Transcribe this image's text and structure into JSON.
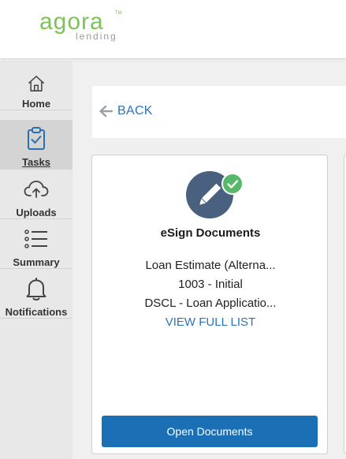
{
  "brand": {
    "name": "agora",
    "sub": "lending",
    "tm": "TM",
    "color": "#7cc35a"
  },
  "sidebar": {
    "items": [
      {
        "label": "Home",
        "icon": "home-icon",
        "active": false
      },
      {
        "label": "Tasks",
        "icon": "clipboard-check-icon",
        "active": true
      },
      {
        "label": "Uploads",
        "icon": "cloud-upload-icon",
        "active": false
      },
      {
        "label": "Summary",
        "icon": "list-icon",
        "active": false
      },
      {
        "label": "Notifications",
        "icon": "bell-icon",
        "active": false
      }
    ]
  },
  "back": {
    "label": "BACK",
    "icon": "arrow-left-icon"
  },
  "card": {
    "title": "eSign Documents",
    "icon": "pencil-icon",
    "status_icon": "check-icon",
    "documents": [
      "Loan Estimate (Alterna...",
      "1003 - Initial",
      "DSCL - Loan Applicatio..."
    ],
    "view_full_label": "VIEW FULL LIST",
    "button_label": "Open Documents"
  },
  "colors": {
    "accent": "#1b6fb5",
    "link": "#2e72b8",
    "icon_bg": "#49617f",
    "success": "#57b76a",
    "sidebar_bg": "#e8e8e8"
  }
}
